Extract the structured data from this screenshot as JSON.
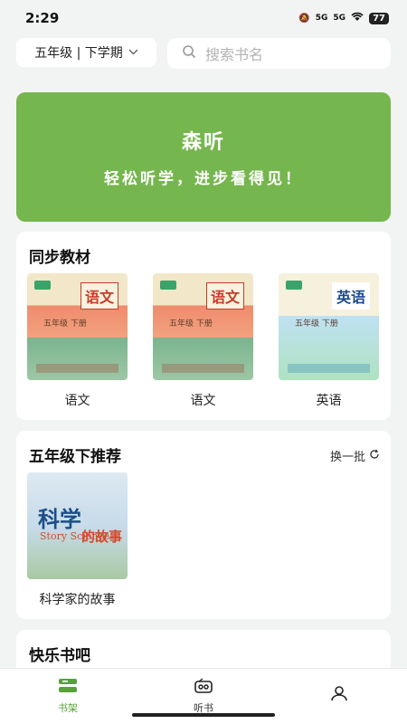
{
  "status": {
    "time": "2:29",
    "battery": "77",
    "sig1": "5G",
    "sig2": "5G"
  },
  "grade_select": {
    "label": "五年级 | 下学期"
  },
  "search": {
    "placeholder": "搜索书名"
  },
  "banner": {
    "title": "森听",
    "subtitle": "轻松听学，进步看得见！"
  },
  "sync_textbooks": {
    "title": "同步教材",
    "books": [
      {
        "label": "语文",
        "cover_title": "语文",
        "cover_grade": "五年级 下册"
      },
      {
        "label": "语文",
        "cover_title": "语文",
        "cover_grade": "五年级 下册"
      },
      {
        "label": "英语",
        "cover_title": "英语",
        "cover_grade": "五年级 下册"
      }
    ]
  },
  "recommend": {
    "title": "五年级下推荐",
    "refresh_label": "换一批",
    "book": {
      "label": "科学家的故事",
      "cover_title": "科学",
      "cover_sub": "Story Science",
      "cover_sub2": "的故事"
    }
  },
  "happy_bookbar": {
    "title": "快乐书吧"
  },
  "nav": {
    "items": [
      {
        "label": "书架",
        "icon": "bookshelf-icon",
        "active": true
      },
      {
        "label": "听书",
        "icon": "radio-icon",
        "active": false
      },
      {
        "label": "",
        "icon": "profile-icon",
        "active": false
      }
    ]
  },
  "colors": {
    "banner": "#76b64e",
    "accent": "#58a23a",
    "background": "#f2f4f3"
  }
}
